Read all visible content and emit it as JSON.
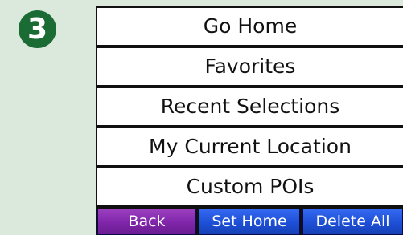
{
  "step_badge": "3",
  "menu": {
    "items": [
      {
        "label": "Go Home"
      },
      {
        "label": "Favorites"
      },
      {
        "label": "Recent Selections"
      },
      {
        "label": "My Current Location"
      },
      {
        "label": "Custom POIs"
      }
    ]
  },
  "buttons": {
    "back_label": "Back",
    "set_home_label": "Set Home",
    "delete_all_label": "Delete All"
  },
  "colors": {
    "background": "#dbe9dc",
    "badge": "#1b6b35",
    "back_button": "#7f25a9",
    "action_buttons": "#1d4fd6"
  }
}
